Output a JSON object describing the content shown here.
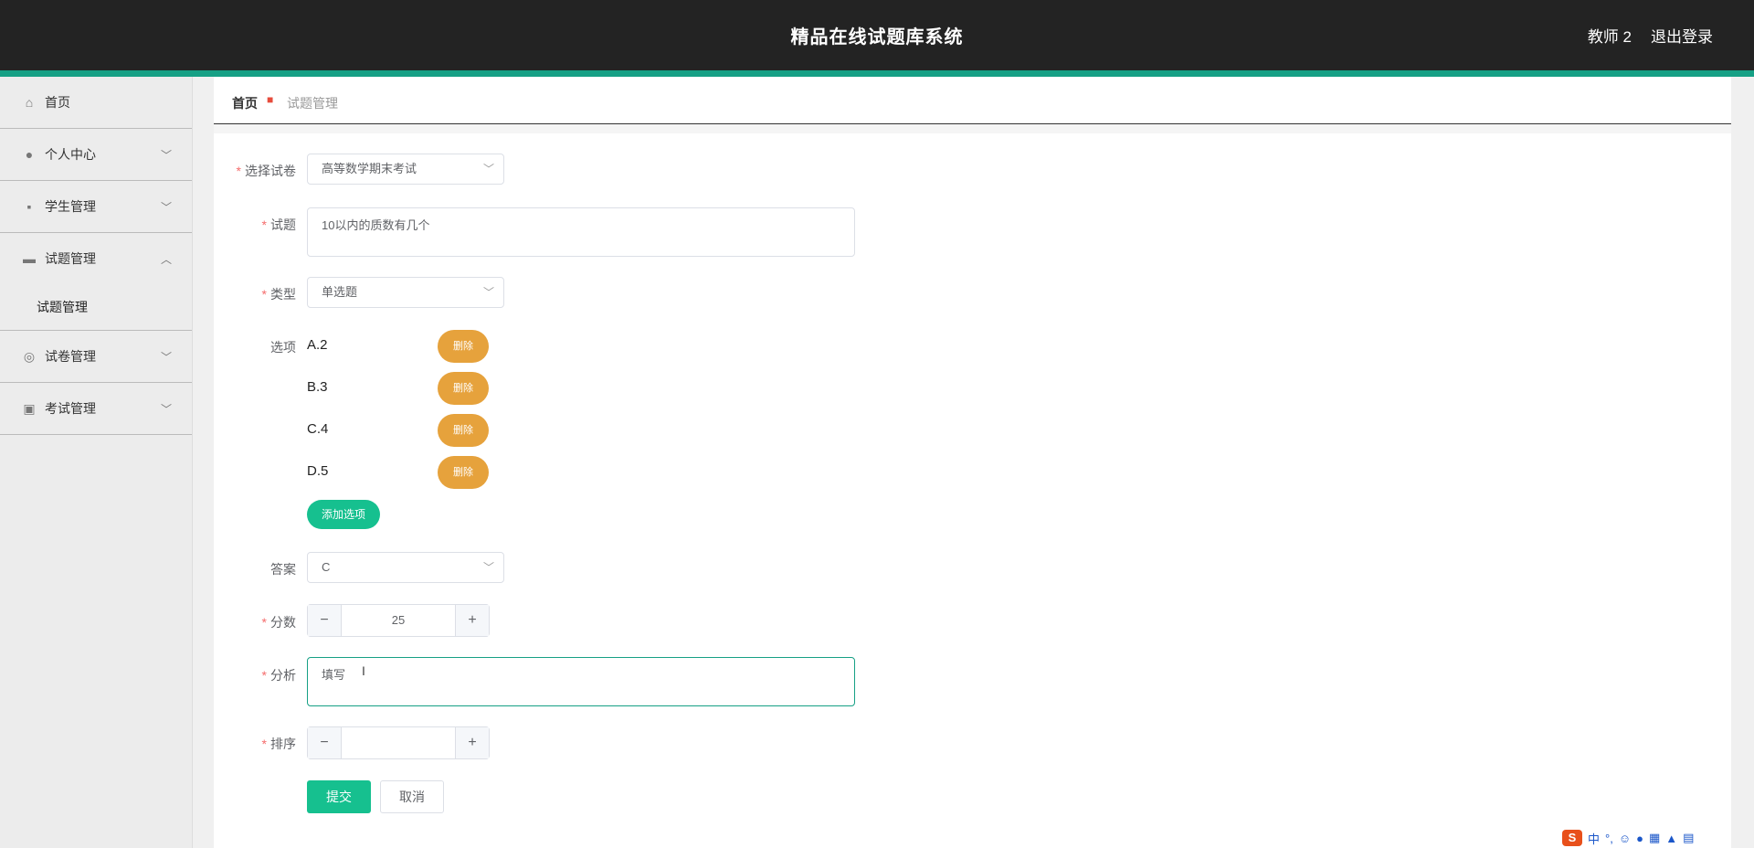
{
  "header": {
    "title": "精品在线试题库系统",
    "user": "教师 2",
    "logout": "退出登录"
  },
  "sidebar": {
    "items": [
      {
        "label": "首页"
      },
      {
        "label": "个人中心"
      },
      {
        "label": "学生管理"
      },
      {
        "label": "试题管理"
      },
      {
        "label": "试卷管理"
      },
      {
        "label": "考试管理"
      }
    ],
    "submenu": {
      "label": "试题管理"
    }
  },
  "breadcrumb": {
    "home": "首页",
    "current": "试题管理"
  },
  "form": {
    "paper": {
      "label": "选择试卷",
      "value": "高等数学期末考试"
    },
    "question": {
      "label": "试题",
      "value": "10以内的质数有几个"
    },
    "type": {
      "label": "类型",
      "value": "单选题"
    },
    "options": {
      "label": "选项",
      "items": [
        {
          "text": "A.2",
          "delete_label": "删除"
        },
        {
          "text": "B.3",
          "delete_label": "删除"
        },
        {
          "text": "C.4",
          "delete_label": "删除"
        },
        {
          "text": "D.5",
          "delete_label": "删除"
        }
      ],
      "add_label": "添加选项"
    },
    "answer": {
      "label": "答案",
      "value": "C"
    },
    "score": {
      "label": "分数",
      "value": "25",
      "minus": "−",
      "plus": "+"
    },
    "analysis": {
      "label": "分析",
      "value": "填写"
    },
    "order": {
      "label": "排序",
      "value": "",
      "minus": "−",
      "plus": "+"
    },
    "submit_label": "提交",
    "cancel_label": "取消"
  },
  "ime": {
    "logo": "S",
    "mode": "中"
  }
}
